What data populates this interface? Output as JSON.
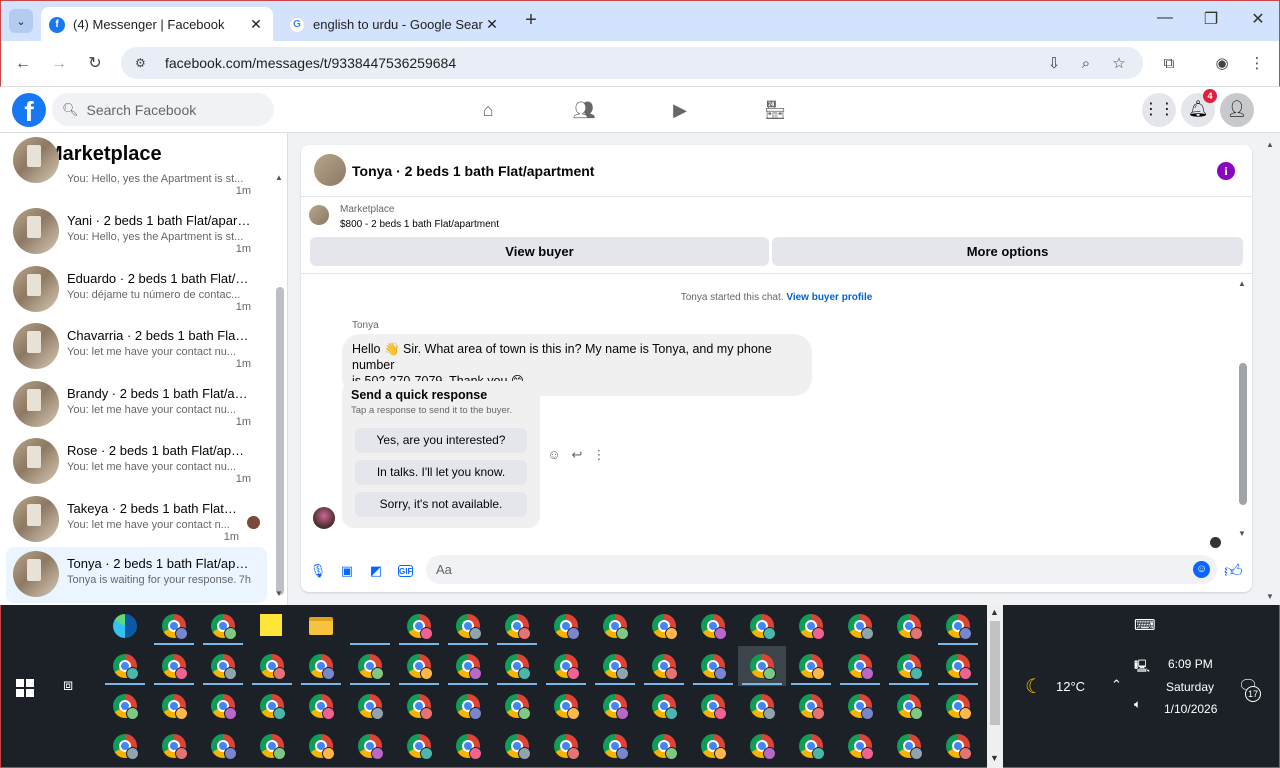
{
  "browser": {
    "tabs": [
      {
        "title": "(4) Messenger | Facebook",
        "favicon": "facebook-icon",
        "active": true
      },
      {
        "title": "english to urdu - Google Search",
        "favicon": "google-icon",
        "active": false
      }
    ],
    "url": "facebook.com/messages/t/9338447536259684"
  },
  "fb": {
    "search_placeholder": "Search Facebook",
    "notifications_count": "4"
  },
  "left_panel": {
    "title": "Marketplace",
    "conversations": [
      {
        "name": "",
        "snippet": "You: Hello, yes the Apartment is st...",
        "time": "1m"
      },
      {
        "name": "Yani · 2 beds 1 bath Flat/apartm...",
        "snippet": "You: Hello, yes the Apartment is st...",
        "time": "1m"
      },
      {
        "name": "Eduardo · 2 beds 1 bath Flat/ap...",
        "snippet": "You: déjame tu número de contac...",
        "time": "1m"
      },
      {
        "name": "Chavarria · 2 beds 1 bath Flat/a...",
        "snippet": "You: let me have your contact nu...",
        "time": "1m"
      },
      {
        "name": "Brandy · 2 beds 1 bath Flat/apar...",
        "snippet": "You: let me have your contact nu...",
        "time": "1m"
      },
      {
        "name": "Rose · 2 beds 1 bath Flat/apart...",
        "snippet": "You: let me have your contact nu...",
        "time": "1m"
      },
      {
        "name": "Takeya · 2 beds 1 bath Flat/ap...",
        "snippet": "You: let me have your contact n...",
        "time": "1m"
      },
      {
        "name": "Tonya · 2 beds 1 bath Flat/apart...",
        "snippet": "Tonya is waiting for your response.",
        "time": "7h"
      }
    ]
  },
  "chat": {
    "title": "Tonya · 2 beds 1 bath Flat/apartment",
    "marketplace_label": "Marketplace",
    "listing": "$800 - 2 beds 1 bath Flat/apartment",
    "view_buyer": "View buyer",
    "more_options": "More options",
    "system_msg": "Tonya started this chat.",
    "system_link": "View buyer profile",
    "sender": "Tonya",
    "message_part1": "Hello 👋 Sir. What area of town is this in? My name is Tonya, and my phone number",
    "message_part2": "is 502-270-7079. Thank you 😊",
    "quick": {
      "heading": "Send a quick response",
      "sub": "Tap a response to send it to the buyer.",
      "options": [
        "Yes, are you interested?",
        "In talks. I'll let you know.",
        "Sorry, it's not available."
      ]
    },
    "composer_placeholder": "Aa"
  },
  "taskbar": {
    "weather_temp": "12°C",
    "time": "6:09 PM",
    "day": "Saturday",
    "date": "1/10/2026",
    "notifications": "17"
  },
  "colors": {
    "fb_blue": "#1877f2",
    "messenger_blue": "#0866ff",
    "badge_red": "#e41e3f",
    "info_purple": "#8a05be"
  }
}
